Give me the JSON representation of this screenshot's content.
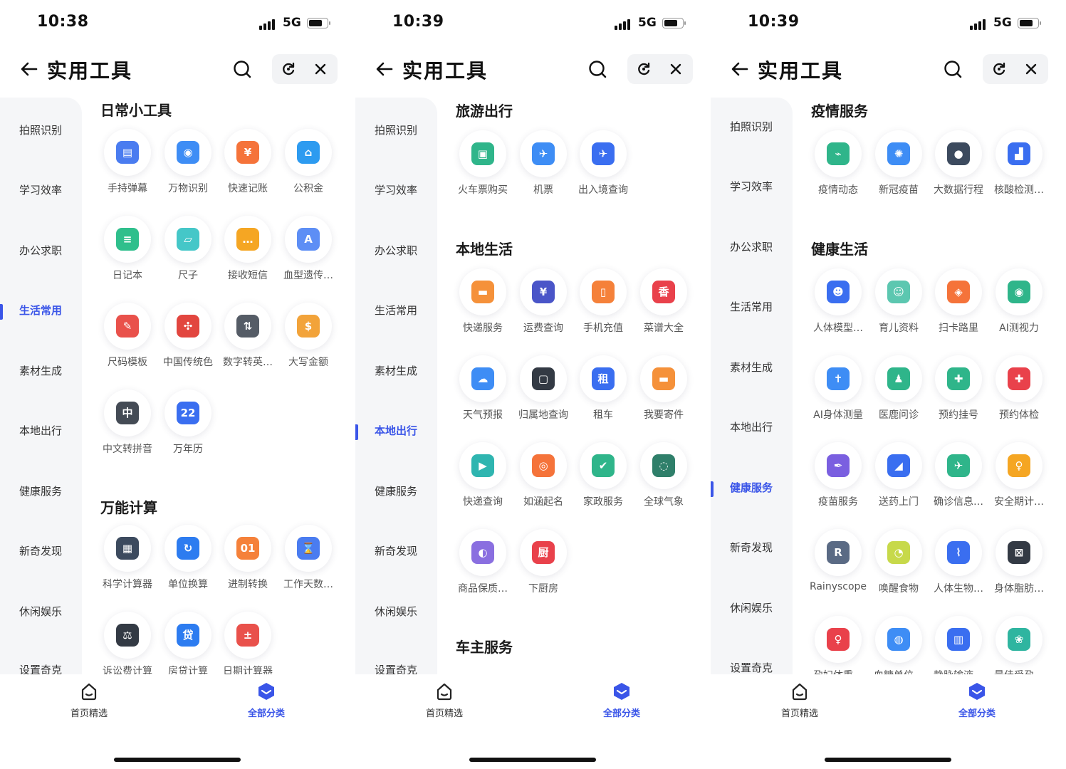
{
  "accent_color": "#3a55e8",
  "screens": [
    {
      "status": {
        "time": "10:38",
        "network": "5G"
      },
      "nav": {
        "title": "实用工具"
      },
      "sidebar": {
        "items": [
          "拍照识别",
          "学习效率",
          "办公求职",
          "生活常用",
          "素材生成",
          "本地出行",
          "健康服务",
          "新奇发现",
          "休闲娱乐",
          "设置奇克"
        ],
        "active_index": 3
      },
      "sections": [
        {
          "title": "日常小工具",
          "tools": [
            {
              "label": "手持弹幕",
              "icon": "danmaku-icon",
              "glyph": "▤",
              "color": "#4a7cf0"
            },
            {
              "label": "万物识别",
              "icon": "camera-icon",
              "glyph": "◉",
              "color": "#3e8df5"
            },
            {
              "label": "快速记账",
              "icon": "ledger-icon",
              "glyph": "¥",
              "color": "#f5733a"
            },
            {
              "label": "公积金",
              "icon": "house-fund-icon",
              "glyph": "⌂",
              "color": "#2d9bf0"
            },
            {
              "label": "日记本",
              "icon": "notebook-icon",
              "glyph": "≡",
              "color": "#2fbf8c"
            },
            {
              "label": "尺子",
              "icon": "ruler-icon",
              "glyph": "▱",
              "color": "#45c7c8"
            },
            {
              "label": "接收短信",
              "icon": "sms-icon",
              "glyph": "…",
              "color": "#f5a623"
            },
            {
              "label": "血型遗传…",
              "icon": "blood-type-icon",
              "glyph": "A",
              "color": "#5d8ef5"
            },
            {
              "label": "尺码模板",
              "icon": "size-template-icon",
              "glyph": "✎",
              "color": "#e9514b"
            },
            {
              "label": "中国传统色",
              "icon": "chinese-knot-icon",
              "glyph": "✣",
              "color": "#e2463f"
            },
            {
              "label": "数字转英…",
              "icon": "number-convert-icon",
              "glyph": "⇅",
              "color": "#555c66"
            },
            {
              "label": "大写金额",
              "icon": "coins-icon",
              "glyph": "$",
              "color": "#f2a33a"
            },
            {
              "label": "中文转拼音",
              "icon": "pinyin-icon",
              "glyph": "中",
              "color": "#444b55"
            },
            {
              "label": "万年历",
              "icon": "calendar-icon",
              "glyph": "22",
              "color": "#3a6ef0"
            }
          ]
        },
        {
          "title": "万能计算",
          "tools": [
            {
              "label": "科学计算器",
              "icon": "calculator-icon",
              "glyph": "▦",
              "color": "#3c4a5e"
            },
            {
              "label": "单位换算",
              "icon": "unit-convert-icon",
              "glyph": "↻",
              "color": "#2d7cf0"
            },
            {
              "label": "进制转换",
              "icon": "binary-icon",
              "glyph": "01",
              "color": "#f5813a"
            },
            {
              "label": "工作天数…",
              "icon": "hourglass-icon",
              "glyph": "⌛",
              "color": "#4a7cf0"
            },
            {
              "label": "诉讼费计算",
              "icon": "gavel-icon",
              "glyph": "⚖",
              "color": "#333a44"
            },
            {
              "label": "房贷计算",
              "icon": "loan-icon",
              "glyph": "贷",
              "color": "#2d7cf0"
            },
            {
              "label": "日期计算器",
              "icon": "date-calc-icon",
              "glyph": "±",
              "color": "#e9514b"
            }
          ]
        }
      ],
      "tabbar": {
        "home": "首页精选",
        "all": "全部分类"
      }
    },
    {
      "status": {
        "time": "10:39",
        "network": "5G"
      },
      "nav": {
        "title": "实用工具"
      },
      "sidebar": {
        "items": [
          "拍照识别",
          "学习效率",
          "办公求职",
          "生活常用",
          "素材生成",
          "本地出行",
          "健康服务",
          "新奇发现",
          "休闲娱乐",
          "设置奇克"
        ],
        "active_index": 5
      },
      "sections": [
        {
          "title": "旅游出行",
          "tools": [
            {
              "label": "火车票购买",
              "icon": "train-icon",
              "glyph": "▣",
              "color": "#2fb58a"
            },
            {
              "label": "机票",
              "icon": "plane-ticket-icon",
              "glyph": "✈",
              "color": "#3e8df5"
            },
            {
              "label": "出入境查询",
              "icon": "globe-plane-icon",
              "glyph": "✈",
              "color": "#3a6ef0"
            }
          ]
        },
        {
          "title": "本地生活",
          "tools": [
            {
              "label": "快递服务",
              "icon": "parcel-icon",
              "glyph": "▬",
              "color": "#f5913a"
            },
            {
              "label": "运费查询",
              "icon": "freight-icon",
              "glyph": "¥",
              "color": "#4a55c8"
            },
            {
              "label": "手机充值",
              "icon": "phone-icon",
              "glyph": "▯",
              "color": "#f5813a"
            },
            {
              "label": "菜谱大全",
              "icon": "recipe-icon",
              "glyph": "香",
              "color": "#e9414b"
            },
            {
              "label": "天气预报",
              "icon": "weather-icon",
              "glyph": "☁",
              "color": "#3e8df5"
            },
            {
              "label": "归属地查询",
              "icon": "location-lookup-icon",
              "glyph": "▢",
              "color": "#333a44"
            },
            {
              "label": "租车",
              "icon": "car-rental-icon",
              "glyph": "租",
              "color": "#3a6ef0"
            },
            {
              "label": "我要寄件",
              "icon": "send-parcel-icon",
              "glyph": "▬",
              "color": "#f5913a"
            },
            {
              "label": "快递查询",
              "icon": "truck-icon",
              "glyph": "▶",
              "color": "#2fb5b0"
            },
            {
              "label": "如涵起名",
              "icon": "naming-icon",
              "glyph": "◎",
              "color": "#f5733a"
            },
            {
              "label": "家政服务",
              "icon": "housekeeping-icon",
              "glyph": "✔",
              "color": "#2fb58a"
            },
            {
              "label": "全球气象",
              "icon": "satellite-weather-icon",
              "glyph": "◌",
              "color": "#2f7f6a"
            },
            {
              "label": "商品保质…",
              "icon": "shopping-bag-icon",
              "glyph": "◐",
              "color": "#8a6fe0"
            },
            {
              "label": "下厨房",
              "icon": "kitchen-icon",
              "glyph": "厨",
              "color": "#e9414b"
            }
          ]
        },
        {
          "title": "车主服务",
          "tools": []
        }
      ],
      "tabbar": {
        "home": "首页精选",
        "all": "全部分类"
      }
    },
    {
      "status": {
        "time": "10:39",
        "network": "5G"
      },
      "nav": {
        "title": "实用工具"
      },
      "sidebar": {
        "items": [
          "拍照识别",
          "学习效率",
          "办公求职",
          "生活常用",
          "素材生成",
          "本地出行",
          "健康服务",
          "新奇发现",
          "休闲娱乐",
          "设置奇克"
        ],
        "active_index": 6
      },
      "sections": [
        {
          "title": "疫情服务",
          "tools": [
            {
              "label": "疫情动态",
              "icon": "epidemic-trend-icon",
              "glyph": "⌁",
              "color": "#2fb58a"
            },
            {
              "label": "新冠疫苗",
              "icon": "vaccine-shield-icon",
              "glyph": "✺",
              "color": "#3e8df5"
            },
            {
              "label": "大数据行程",
              "icon": "itinerary-icon",
              "glyph": "●",
              "color": "#3c4a5e"
            },
            {
              "label": "核酸检测…",
              "icon": "nucleic-test-icon",
              "glyph": "▟",
              "color": "#3a6ef0"
            }
          ]
        },
        {
          "title": "健康生活",
          "tools": [
            {
              "label": "人体模型…",
              "icon": "body-model-icon",
              "glyph": "☻",
              "color": "#3a6ef0"
            },
            {
              "label": "育儿资料",
              "icon": "baby-icon",
              "glyph": "☺",
              "color": "#5cc7b0"
            },
            {
              "label": "扫卡路里",
              "icon": "calorie-scan-icon",
              "glyph": "◈",
              "color": "#f5733a"
            },
            {
              "label": "AI测视力",
              "icon": "eye-icon",
              "glyph": "◉",
              "color": "#2fb58a"
            },
            {
              "label": "AI身体测量",
              "icon": "body-measure-icon",
              "glyph": "✝",
              "color": "#3e8df5"
            },
            {
              "label": "医鹿问诊",
              "icon": "doctor-icon",
              "glyph": "♟",
              "color": "#2fb58a"
            },
            {
              "label": "预约挂号",
              "icon": "register-icon",
              "glyph": "✚",
              "color": "#2fb58a"
            },
            {
              "label": "预约体检",
              "icon": "checkup-icon",
              "glyph": "✚",
              "color": "#e9414b"
            },
            {
              "label": "疫苗服务",
              "icon": "syringe-icon",
              "glyph": "✒",
              "color": "#7a5fe0"
            },
            {
              "label": "送药上门",
              "icon": "medicine-delivery-icon",
              "glyph": "◢",
              "color": "#3a6ef0"
            },
            {
              "label": "确诊信息…",
              "icon": "diagnosis-icon",
              "glyph": "✈",
              "color": "#2fb58a"
            },
            {
              "label": "安全期计…",
              "icon": "safe-period-icon",
              "glyph": "♀",
              "color": "#f5a623"
            },
            {
              "label": "Rainyscope",
              "icon": "rainyscope-icon",
              "glyph": "R",
              "color": "#5a6a84"
            },
            {
              "label": "唤醒食物",
              "icon": "food-icon",
              "glyph": "◔",
              "color": "#c7d94a"
            },
            {
              "label": "人体生物…",
              "icon": "biorhythm-icon",
              "glyph": "⌇",
              "color": "#3a6ef0"
            },
            {
              "label": "身体脂肪…",
              "icon": "body-fat-icon",
              "glyph": "⊠",
              "color": "#333a44"
            },
            {
              "label": "孕妇体重…",
              "icon": "pregnancy-icon",
              "glyph": "♀",
              "color": "#e9414b"
            },
            {
              "label": "血糖单位…",
              "icon": "blood-sugar-icon",
              "glyph": "◍",
              "color": "#3e8df5"
            },
            {
              "label": "静脉输液…",
              "icon": "iv-drip-icon",
              "glyph": "▥",
              "color": "#3a6ef0"
            },
            {
              "label": "最佳受孕…",
              "icon": "fertility-icon",
              "glyph": "❀",
              "color": "#2fb5a0"
            }
          ]
        }
      ],
      "tabbar": {
        "home": "首页精选",
        "all": "全部分类"
      }
    }
  ]
}
